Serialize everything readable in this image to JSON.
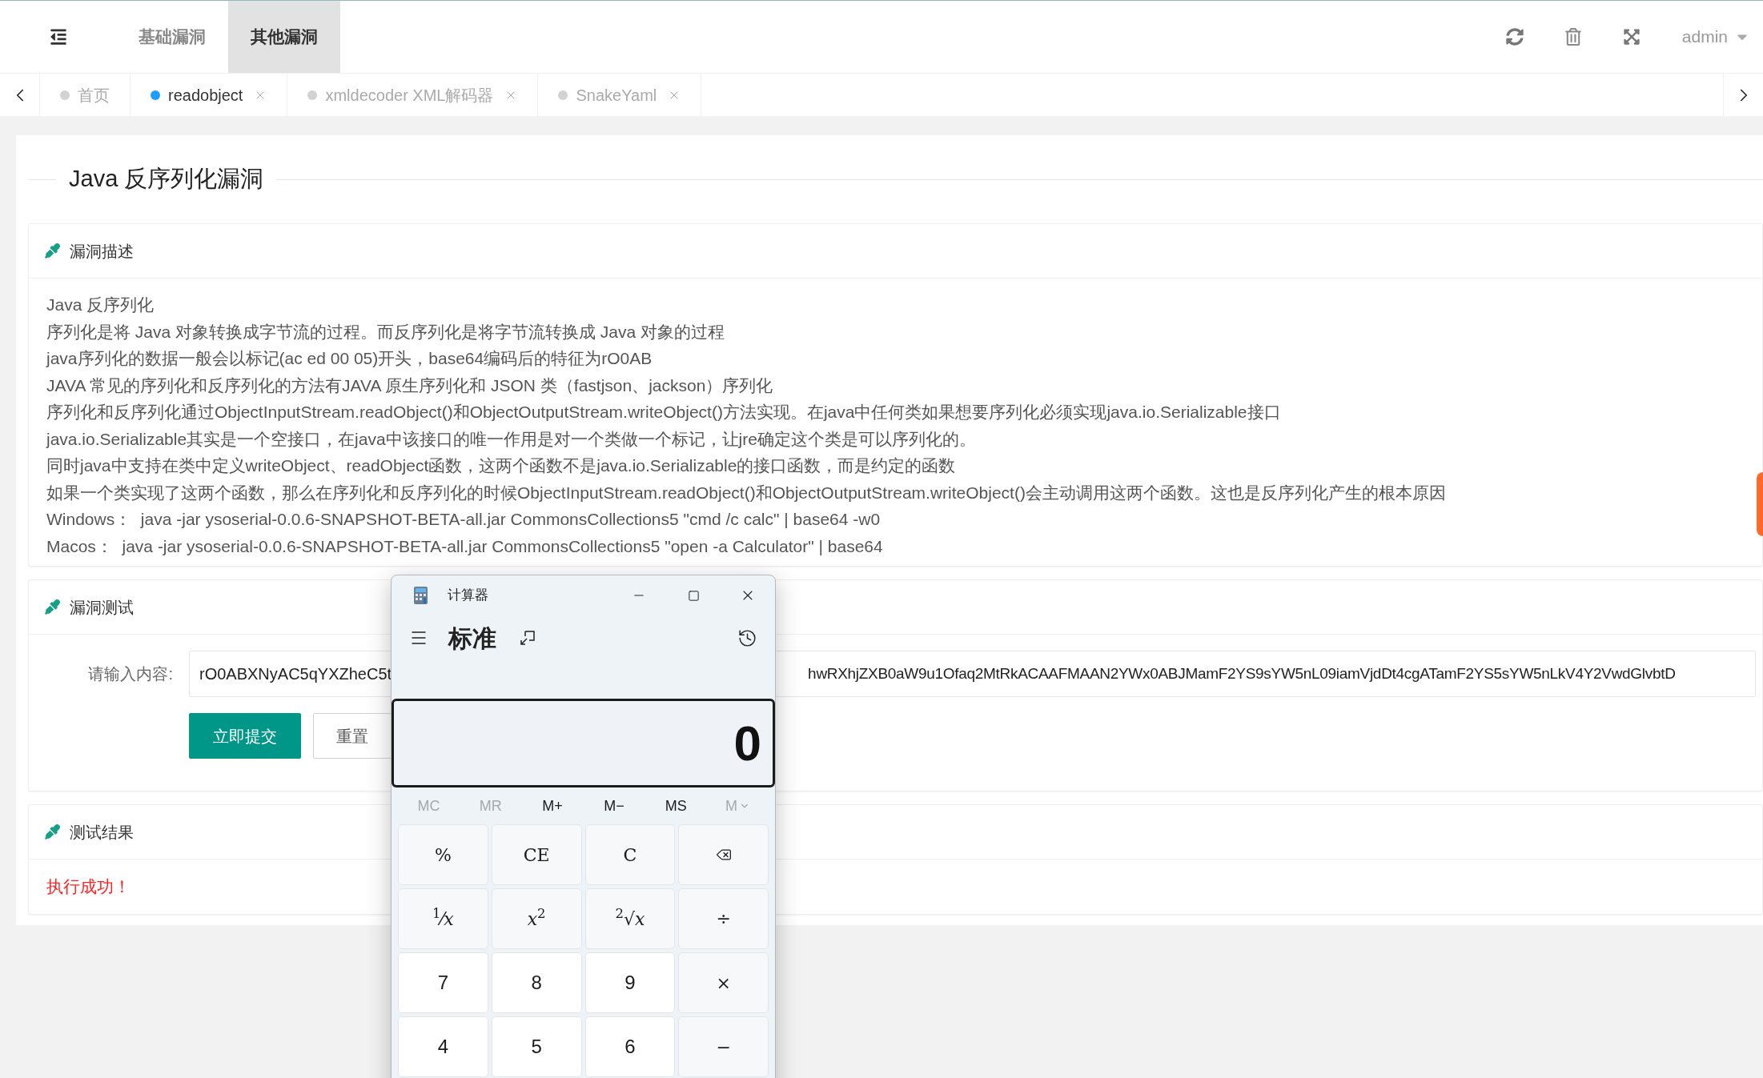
{
  "header": {
    "nav": [
      {
        "label": "基础漏洞",
        "selected": false
      },
      {
        "label": "其他漏洞",
        "selected": true
      }
    ],
    "user": "admin"
  },
  "tabs": [
    {
      "label": "首页",
      "selected": false,
      "closable": false
    },
    {
      "label": "readobject",
      "selected": true,
      "closable": true
    },
    {
      "label": "xmldecoder XML解码器",
      "selected": false,
      "closable": true
    },
    {
      "label": "SnakeYaml",
      "selected": false,
      "closable": true
    }
  ],
  "page": {
    "title": "Java 反序列化漏洞",
    "description": {
      "title": "漏洞描述",
      "lines": [
        "Java 反序列化",
        "序列化是将 Java 对象转换成字节流的过程。而反序列化是将字节流转换成 Java 对象的过程",
        "java序列化的数据一般会以标记(ac ed 00 05)开头，base64编码后的特征为rO0AB",
        "JAVA 常见的序列化和反序列化的方法有JAVA 原生序列化和 JSON 类（fastjson、jackson）序列化",
        "序列化和反序列化通过ObjectInputStream.readObject()和ObjectOutputStream.writeObject()方法实现。在java中任何类如果想要序列化必须实现java.io.Serializable接口",
        "java.io.Serializable其实是一个空接口，在java中该接口的唯一作用是对一个类做一个标记，让jre确定这个类是可以序列化的。",
        "同时java中支持在类中定义writeObject、readObject函数，这两个函数不是java.io.Serializable的接口函数，而是约定的函数",
        "如果一个类实现了这两个函数，那么在序列化和反序列化的时候ObjectInputStream.readObject()和ObjectOutputStream.writeObject()会主动调用这两个函数。这也是反序列化产生的根本原因",
        "Windows：  java -jar ysoserial-0.0.6-SNAPSHOT-BETA-all.jar CommonsCollections5 \"cmd /c calc\" | base64 -w0",
        "Macos：  java -jar ysoserial-0.0.6-SNAPSHOT-BETA-all.jar CommonsCollections5 \"open -a Calculator\" | base64"
      ]
    },
    "test": {
      "title": "漏洞测试",
      "label": "请输入内容:",
      "value_left": "rO0ABXNyAC5qYXZheC5t",
      "value_right": "hwRXhjZXB0aW9u1Ofaq2MtRkACAAFMAAN2YWx0ABJMamF2YS9sYW5nL09iamVjdDt4cgATamF2YS5sYW5nLkV4Y2VwdGlvbtD",
      "submit": "立即提交",
      "reset": "重置"
    },
    "result": {
      "title": "测试结果",
      "message": "执行成功！"
    }
  },
  "calculator": {
    "title": "计算器",
    "mode": "标准",
    "display": "0",
    "memory": [
      {
        "label": "MC",
        "disabled": true,
        "dropdown": false
      },
      {
        "label": "MR",
        "disabled": true,
        "dropdown": false
      },
      {
        "label": "M+",
        "disabled": false,
        "dropdown": false
      },
      {
        "label": "M−",
        "disabled": false,
        "dropdown": false
      },
      {
        "label": "MS",
        "disabled": false,
        "dropdown": false
      },
      {
        "label": "M",
        "disabled": true,
        "dropdown": true
      }
    ],
    "keys": [
      {
        "kind": "op",
        "label": "%"
      },
      {
        "kind": "op",
        "label": "CE"
      },
      {
        "kind": "op",
        "label": "C"
      },
      {
        "kind": "backspace"
      },
      {
        "kind": "op",
        "label": "$^{1}$⁄*x*"
      },
      {
        "kind": "op",
        "label": "*x*$^{2}$"
      },
      {
        "kind": "op",
        "label": "$^{2}$√*x*"
      },
      {
        "kind": "op",
        "label": "÷"
      },
      {
        "kind": "digit",
        "label": "7"
      },
      {
        "kind": "digit",
        "label": "8"
      },
      {
        "kind": "digit",
        "label": "9"
      },
      {
        "kind": "op",
        "label": "×"
      },
      {
        "kind": "digit",
        "label": "4"
      },
      {
        "kind": "digit",
        "label": "5"
      },
      {
        "kind": "digit",
        "label": "6"
      },
      {
        "kind": "op",
        "label": "−"
      }
    ]
  }
}
